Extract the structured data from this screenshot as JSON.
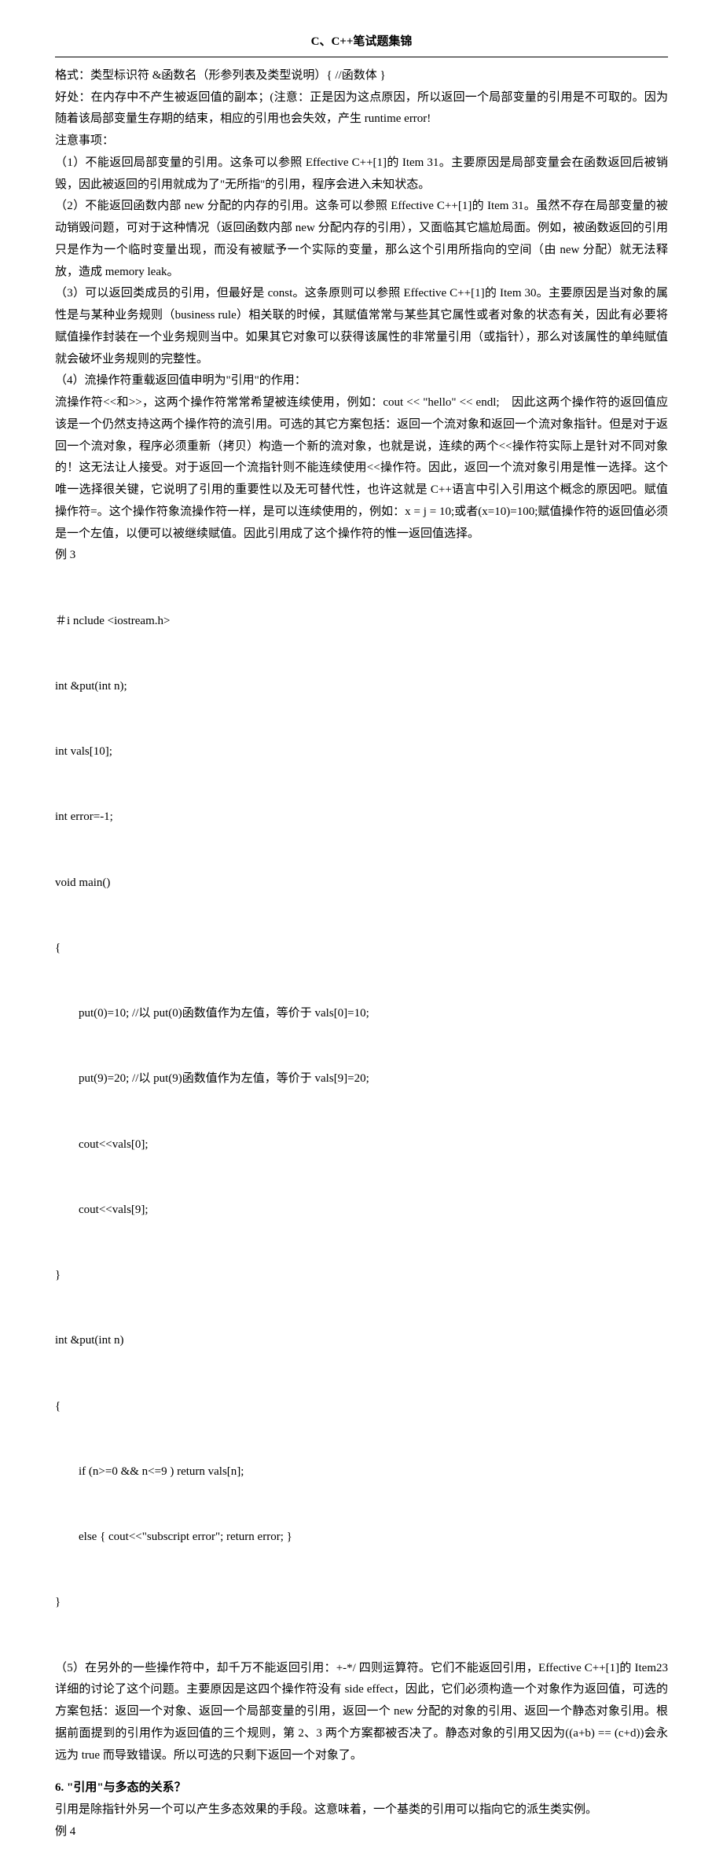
{
  "header": {
    "title": "C、C++笔试题集锦"
  },
  "body": {
    "p1": "格式：类型标识符 &函数名（形参列表及类型说明）{ //函数体 }",
    "p2": "好处：在内存中不产生被返回值的副本；(注意：正是因为这点原因，所以返回一个局部变量的引用是不可取的。因为随着该局部变量生存期的结束，相应的引用也会失效，产生 runtime error!",
    "p3": "注意事项：",
    "p4": "（1）不能返回局部变量的引用。这条可以参照 Effective C++[1]的 Item 31。主要原因是局部变量会在函数返回后被销毁，因此被返回的引用就成为了\"无所指\"的引用，程序会进入未知状态。",
    "p5": "（2）不能返回函数内部 new 分配的内存的引用。这条可以参照 Effective C++[1]的 Item 31。虽然不存在局部变量的被动销毁问题，可对于这种情况（返回函数内部 new 分配内存的引用），又面临其它尴尬局面。例如，被函数返回的引用只是作为一个临时变量出现，而没有被赋予一个实际的变量，那么这个引用所指向的空间（由 new 分配）就无法释放，造成 memory leak。",
    "p6": "（3）可以返回类成员的引用，但最好是 const。这条原则可以参照 Effective C++[1]的 Item 30。主要原因是当对象的属性是与某种业务规则（business rule）相关联的时候，其赋值常常与某些其它属性或者对象的状态有关，因此有必要将赋值操作封装在一个业务规则当中。如果其它对象可以获得该属性的非常量引用（或指针），那么对该属性的单纯赋值就会破坏业务规则的完整性。",
    "p7": "（4）流操作符重载返回值申明为\"引用\"的作用：",
    "p8": "流操作符<<和>>，这两个操作符常常希望被连续使用，例如：cout << \"hello\" << endl;　因此这两个操作符的返回值应该是一个仍然支持这两个操作符的流引用。可选的其它方案包括：返回一个流对象和返回一个流对象指针。但是对于返回一个流对象，程序必须重新（拷贝）构造一个新的流对象，也就是说，连续的两个<<操作符实际上是针对不同对象的！这无法让人接受。对于返回一个流指针则不能连续使用<<操作符。因此，返回一个流对象引用是惟一选择。这个唯一选择很关键，它说明了引用的重要性以及无可替代性，也许这就是 C++语言中引入引用这个概念的原因吧。赋值操作符=。这个操作符象流操作符一样，是可以连续使用的，例如：x = j = 10;或者(x=10)=100;赋值操作符的返回值必须是一个左值，以便可以被继续赋值。因此引用成了这个操作符的惟一返回值选择。",
    "example3_label": "例 3",
    "code": {
      "l1": "＃i nclude <iostream.h>",
      "l2": "int &put(int n);",
      "l3": "int vals[10];",
      "l4": "int error=-1;",
      "l5": "void main()",
      "l6": "{",
      "l7": "put(0)=10; //以 put(0)函数值作为左值，等价于 vals[0]=10;",
      "l8": "put(9)=20; //以 put(9)函数值作为左值，等价于 vals[9]=20;",
      "l9": "cout<<vals[0];",
      "l10": "cout<<vals[9];",
      "l11": "}",
      "l12": "int &put(int n)",
      "l13": "{",
      "l14": "if (n>=0 && n<=9 ) return vals[n];",
      "l15": "else { cout<<\"subscript error\"; return error; }",
      "l16": "}"
    },
    "p9": "（5）在另外的一些操作符中，却千万不能返回引用：+-*/ 四则运算符。它们不能返回引用，Effective C++[1]的 Item23 详细的讨论了这个问题。主要原因是这四个操作符没有 side effect，因此，它们必须构造一个对象作为返回值，可选的方案包括：返回一个对象、返回一个局部变量的引用，返回一个 new 分配的对象的引用、返回一个静态对象引用。根据前面提到的引用作为返回值的三个规则，第 2、3 两个方案都被否决了。静态对象的引用又因为((a+b) == (c+d))会永远为 true 而导致错误。所以可选的只剩下返回一个对象了。",
    "q6": "6. \"引用\"与多态的关系？",
    "p10": "引用是除指针外另一个可以产生多态效果的手段。这意味着，一个基类的引用可以指向它的派生类实例。",
    "example4_label": "例 4"
  }
}
